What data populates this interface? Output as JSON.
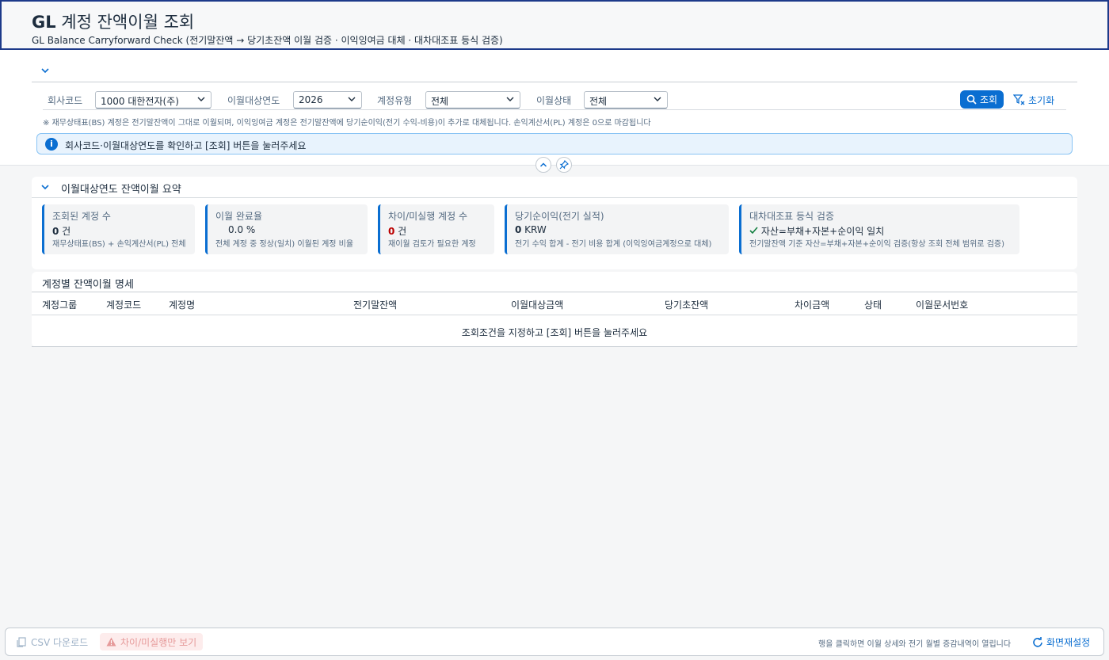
{
  "header": {
    "title_bold": "GL",
    "title_rest": " 계정 잔액이월 조회",
    "subtitle": "GL Balance Carryforward Check (전기말잔액 → 당기초잔액 이월 검증 · 이익잉여금 대체 · 대차대조표 등식 검증)"
  },
  "filters": {
    "company_label": "회사코드",
    "company_value": "1000 대한전자(주)",
    "year_label": "이월대상연도",
    "year_value": "2026",
    "type_label": "계정유형",
    "type_value": "전체",
    "status_label": "이월상태",
    "status_value": "전체",
    "search_label": "조회",
    "reset_label": "초기화"
  },
  "note": "※ 재무상태표(BS) 계정은 전기말잔액이 그대로 이월되며, 이익잉여금 계정은 전기말잔액에 당기순이익(전기 수익-비용)이 추가로 대체됩니다. 손익계산서(PL) 계정은 0으로 마감됩니다",
  "info_message": "회사코드·이월대상연도를 확인하고 [조회] 버튼을 눌러주세요",
  "summary": {
    "title": "이월대상연도 잔액이월 요약",
    "cards": [
      {
        "label": "조회된 계정 수",
        "value": "0",
        "unit": " 건",
        "sub": "재무상태표(BS) + 손익계산서(PL) 전체"
      },
      {
        "label": "이월 완료율",
        "value": "0.0 %",
        "sub": "전체 계정 중 정상(일치) 이월된 계정 비율"
      },
      {
        "label": "차이/미실행 계정 수",
        "value": "0",
        "unit": " 건",
        "sub": "재이월 검토가 필요한 계정"
      },
      {
        "label": "당기순이익(전기 실적)",
        "value": "0",
        "unit": " KRW",
        "sub": "전기 수익 합계 - 전기 비용 합계 (이익잉여금계정으로 대체)"
      },
      {
        "label": "대차대조표 등식 검증",
        "value": "자산=부채+자본+순이익 일치",
        "sub": "전기말잔액 기준 자산=부채+자본+순이익 검증(항상 조회 전체 범위로 검증)"
      }
    ]
  },
  "detail": {
    "title": "계정별 잔액이월 명세",
    "columns": [
      "계정그룹",
      "계정코드",
      "계정명",
      "전기말잔액",
      "이월대상금액",
      "당기초잔액",
      "차이금액",
      "상태",
      "이월문서번호"
    ],
    "empty_message": "조회조건을 지정하고 [조회] 버튼을 눌러주세요"
  },
  "footer": {
    "csv_label": "CSV 다운로드",
    "diff_only_label": "차이/미실행만 보기",
    "hint": "행을 클릭하면 이월 상세와 전기 월별 증감내역이 열립니다",
    "refresh_label": "화면재설정"
  },
  "colors": {
    "accent": "#0a6ed1",
    "negative": "#bb0000",
    "positive": "#107e3e",
    "header_border": "#1d3a8a"
  }
}
